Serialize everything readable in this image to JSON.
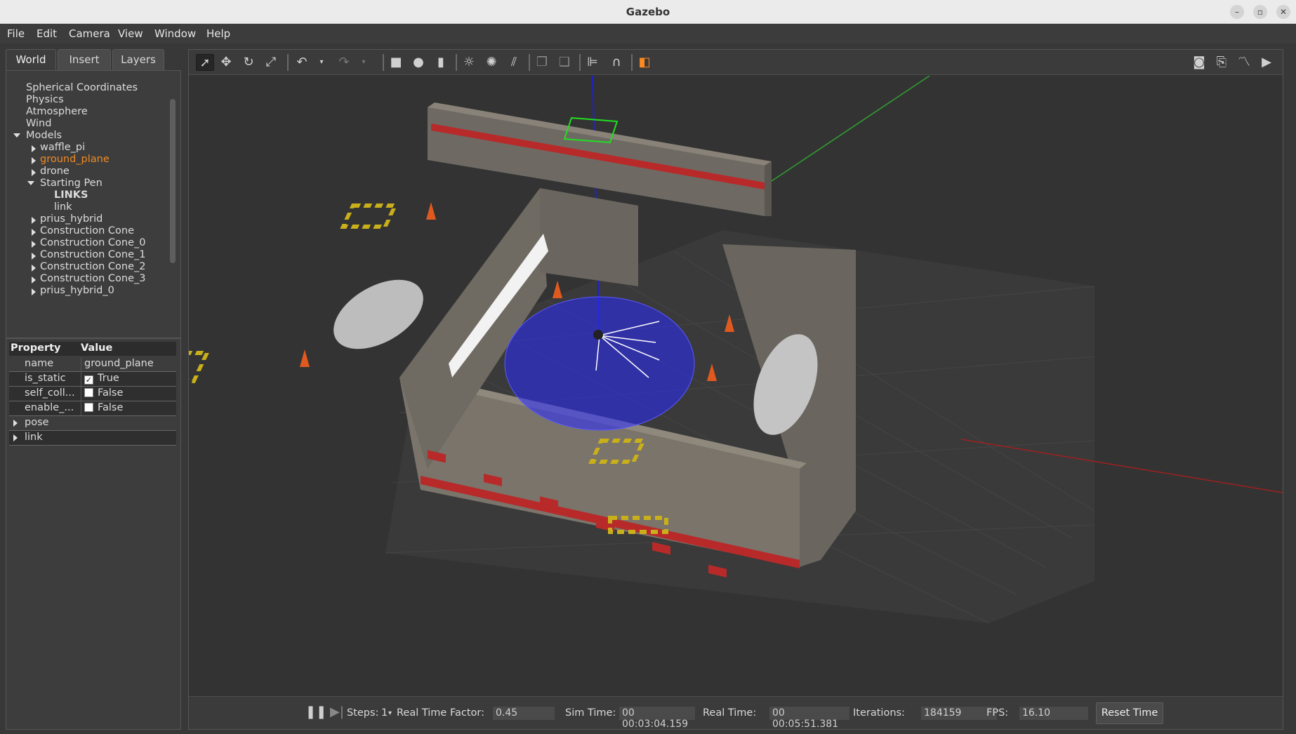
{
  "window": {
    "title": "Gazebo"
  },
  "menu": [
    "File",
    "Edit",
    "Camera",
    "View",
    "Window",
    "Help"
  ],
  "tabs": [
    "World",
    "Insert",
    "Layers"
  ],
  "tree": {
    "items": [
      "Spherical Coordinates",
      "Physics",
      "Atmosphere",
      "Wind",
      "Models",
      "waffle_pi",
      "ground_plane",
      "drone",
      "Starting Pen",
      "LINKS",
      "link",
      "prius_hybrid",
      "Construction Cone",
      "Construction Cone_0",
      "Construction Cone_1",
      "Construction Cone_2",
      "Construction Cone_3",
      "prius_hybrid_0"
    ],
    "selected": "ground_plane"
  },
  "properties": {
    "header_property": "Property",
    "header_value": "Value",
    "rows": [
      {
        "key": "name",
        "value": "ground_plane"
      },
      {
        "key": "is_static",
        "value": "True"
      },
      {
        "key": "self_coll...",
        "value": "False"
      },
      {
        "key": "enable_...",
        "value": "False"
      }
    ],
    "groups": [
      "pose",
      "link"
    ]
  },
  "bottombar": {
    "steps_label": "Steps:",
    "steps_value": "1",
    "rtf_label": "Real Time Factor:",
    "rtf_value": "0.45",
    "sim_label": "Sim Time:",
    "sim_value": "00 00:03:04.159",
    "real_label": "Real Time:",
    "real_value": "00 00:05:51.381",
    "iter_label": "Iterations:",
    "iter_value": "184159",
    "fps_label": "FPS:",
    "fps_value": "16.10",
    "reset_label": "Reset Time"
  },
  "icons": {
    "toolbar": [
      "select-arrow-icon",
      "translate-icon",
      "rotate-icon",
      "scale-icon",
      "undo-icon",
      "redo-icon",
      "box-icon",
      "sphere-icon",
      "cylinder-icon",
      "point-light-icon",
      "spot-light-icon",
      "directional-light-icon",
      "copy-icon",
      "paste-icon",
      "align-icon",
      "snap-icon",
      "view-angle-icon",
      "screenshot-icon",
      "log-icon",
      "plot-icon",
      "video-icon"
    ]
  },
  "colors": {
    "selected": "#f08a24",
    "laser": "#2a2aff",
    "accent_grid_red": "#c03030"
  }
}
